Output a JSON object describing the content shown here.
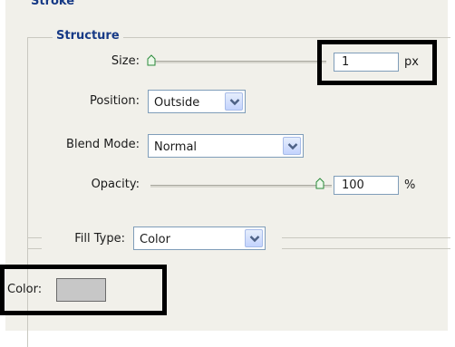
{
  "stroke": {
    "title": "Stroke",
    "structure": {
      "title": "Structure",
      "size": {
        "label": "Size:",
        "value": "1",
        "unit": "px",
        "slider_fraction": 0.0
      },
      "position": {
        "label": "Position:",
        "value": "Outside"
      },
      "blend_mode": {
        "label": "Blend Mode:",
        "value": "Normal"
      },
      "opacity": {
        "label": "Opacity:",
        "value": "100",
        "unit": "%",
        "slider_fraction": 1.0
      }
    },
    "fill": {
      "fill_type": {
        "label": "Fill Type:",
        "value": "Color"
      },
      "color": {
        "label": "Color:",
        "swatch": "#c7c7c7"
      }
    }
  },
  "colors": {
    "legend_text": "#173a86",
    "highlight_box": "#000000",
    "panel_bg": "#f1f0ea"
  }
}
